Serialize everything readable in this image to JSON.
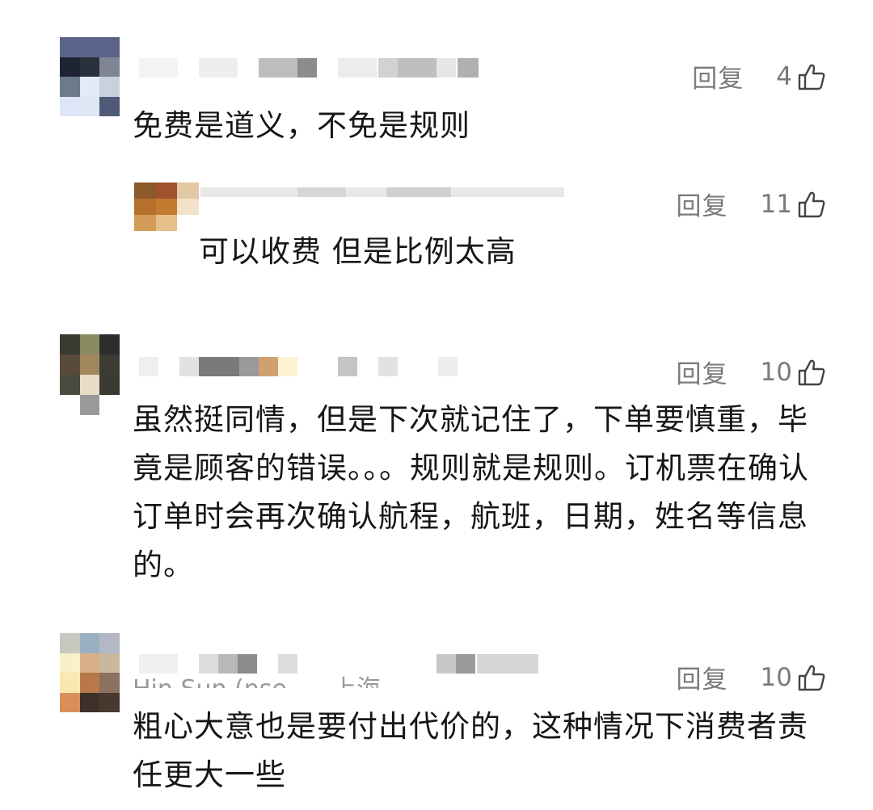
{
  "comments": [
    {
      "reply_label": "回复",
      "likes": "4",
      "text": "免费是道义，不免是规则",
      "replies": [
        {
          "reply_label": "回复",
          "likes": "11",
          "text": "可以收费 但是比例太高"
        }
      ]
    },
    {
      "reply_label": "回复",
      "likes": "10",
      "text": "虽然挺同情，但是下次就记住了，下单要慎重，毕竟是顾客的错误。。。规则就是规则。订机票在确认订单时会再次确认航程，航班，日期，姓名等信息的。"
    },
    {
      "reply_label": "回复",
      "likes": "10",
      "author_partial": "Hin Sun (nse...",
      "location_partial": "上海",
      "text": "粗心大意也是要付出代价的，这种情况下消费者责任更大一些"
    }
  ],
  "icons": {
    "like": "thumbs-up-icon"
  }
}
